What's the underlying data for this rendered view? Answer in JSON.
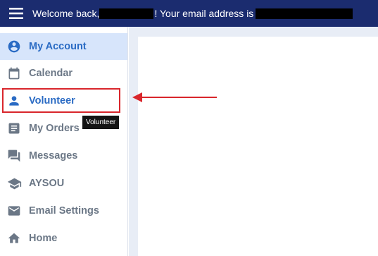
{
  "header": {
    "welcome_prefix": "Welcome back,",
    "email_prefix": "! Your email address is",
    "menu_icon": "hamburger-menu-icon",
    "background": "#1b2c6f"
  },
  "sidebar": {
    "items": [
      {
        "label": "My Account",
        "icon": "account-circle-icon",
        "state": "selected"
      },
      {
        "label": "Calendar",
        "icon": "calendar-icon",
        "state": "normal"
      },
      {
        "label": "Volunteer",
        "icon": "person-icon",
        "state": "highlighted"
      },
      {
        "label": "My Orders",
        "icon": "list-icon",
        "state": "normal"
      },
      {
        "label": "Messages",
        "icon": "messages-icon",
        "state": "normal"
      },
      {
        "label": "AYSOU",
        "icon": "graduation-cap-icon",
        "state": "normal"
      },
      {
        "label": "Email Settings",
        "icon": "envelope-icon",
        "state": "normal"
      },
      {
        "label": "Home",
        "icon": "home-icon",
        "state": "normal"
      }
    ]
  },
  "tooltip": {
    "text": "Volunteer"
  },
  "colors": {
    "accent": "#2a6bc4",
    "selected_bg": "#d7e5fb",
    "annotation_red": "#d9262c",
    "muted_text": "#6b7786"
  }
}
